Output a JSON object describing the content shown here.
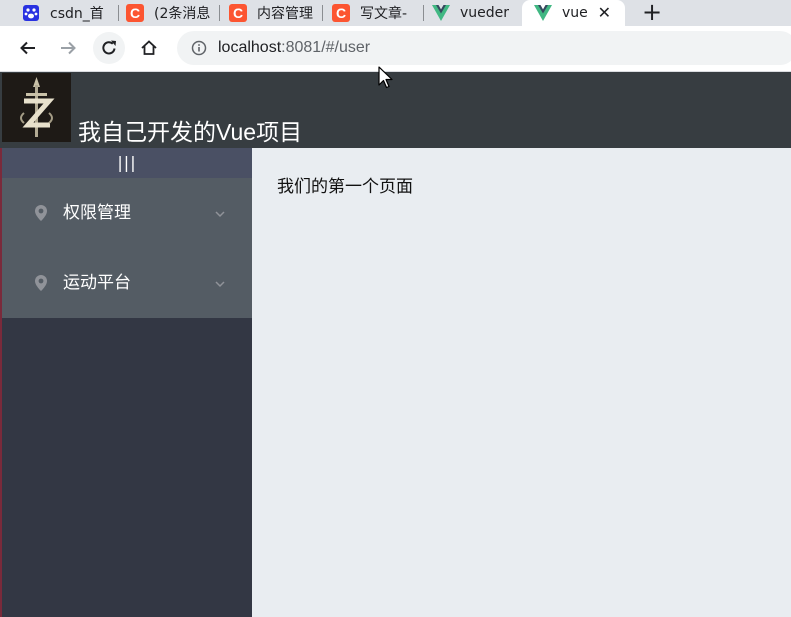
{
  "browser": {
    "tabs": [
      {
        "title": "csdn_首",
        "favicon": "baidu-paw-icon"
      },
      {
        "title": "(2条消息",
        "favicon": "csdn-c-icon"
      },
      {
        "title": "内容管理",
        "favicon": "csdn-c-icon"
      },
      {
        "title": "写文章-",
        "favicon": "csdn-c-icon"
      },
      {
        "title": "vueder",
        "favicon": "vue-logo-icon"
      },
      {
        "title": "vue",
        "favicon": "vue-logo-icon",
        "active": true
      }
    ],
    "close_glyph": "✕",
    "new_tab_glyph": "+",
    "address": {
      "host": "localhost",
      "rest": ":8081/#/user"
    }
  },
  "app": {
    "title": "我自己开发的Vue项目",
    "toggle_label": "|||",
    "menu": [
      {
        "label": "权限管理",
        "icon": "location-pin-icon"
      },
      {
        "label": "运动平台",
        "icon": "location-pin-icon"
      }
    ],
    "main_text": "我们的第一个页面"
  },
  "colors": {
    "header_bg": "#373d41",
    "aside_bg": "#333744",
    "toggle_bg": "#4a5064",
    "menu_bg": "#545c64",
    "main_bg": "#e9edf1",
    "csdn_red": "#fc5531",
    "vue_green": "#41b883"
  }
}
